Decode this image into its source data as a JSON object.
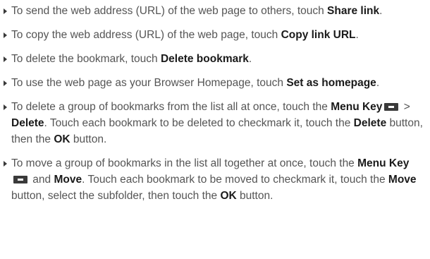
{
  "items": [
    {
      "t1": "To send the web address (URL) of the web page to others, touch ",
      "b1": "Share link",
      "t2": "."
    },
    {
      "t1": "To copy the web address (URL) of the web page, touch ",
      "b1": "Copy link URL",
      "t2": "."
    },
    {
      "t1": "To delete the bookmark, touch ",
      "b1": "Delete bookmark",
      "t2": "."
    },
    {
      "t1": "To use the web page as your Browser Homepage, touch ",
      "b1": "Set as homepage",
      "t2": "."
    },
    {
      "t1": "To delete a group of bookmarks from the list all at once, touch the ",
      "b1": "Menu Key",
      "t2": " > ",
      "b2": "Delete",
      "t3": ". Touch each bookmark to be deleted to checkmark it, touch the ",
      "b3": "Delete",
      "t4": " button, then the ",
      "b4": "OK",
      "t5": " button."
    },
    {
      "t1": "To move a group of bookmarks in the list all together at once, touch the ",
      "b1": "Menu Key",
      "t2": " and ",
      "b2": "Move",
      "t3": ". Touch each bookmark to be moved to checkmark it, touch the ",
      "b3": "Move",
      "t4": " button, select the subfolder, then touch the ",
      "b4": "OK",
      "t5": " button."
    }
  ],
  "icons": {
    "menu_key": "menu-key-icon",
    "bullet": "triangle-bullet-icon"
  }
}
